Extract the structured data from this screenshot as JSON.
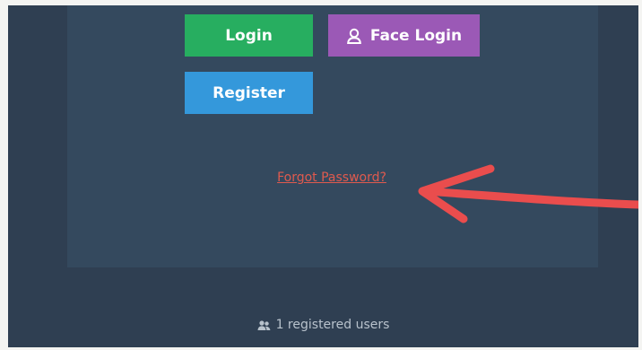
{
  "buttons": {
    "login": "Login",
    "face_login": "Face Login",
    "register": "Register"
  },
  "links": {
    "forgot_password": "Forgot Password?"
  },
  "footer": {
    "registered_users": "1 registered users"
  },
  "icons": {
    "face_login": "user-outline-icon",
    "footer": "users-icon",
    "annotation": "red-arrow"
  },
  "colors": {
    "login": "#27ae60",
    "face_login": "#9b59b6",
    "register": "#3498db",
    "link": "#e05a4e",
    "arrow": "#ea4d4d"
  }
}
